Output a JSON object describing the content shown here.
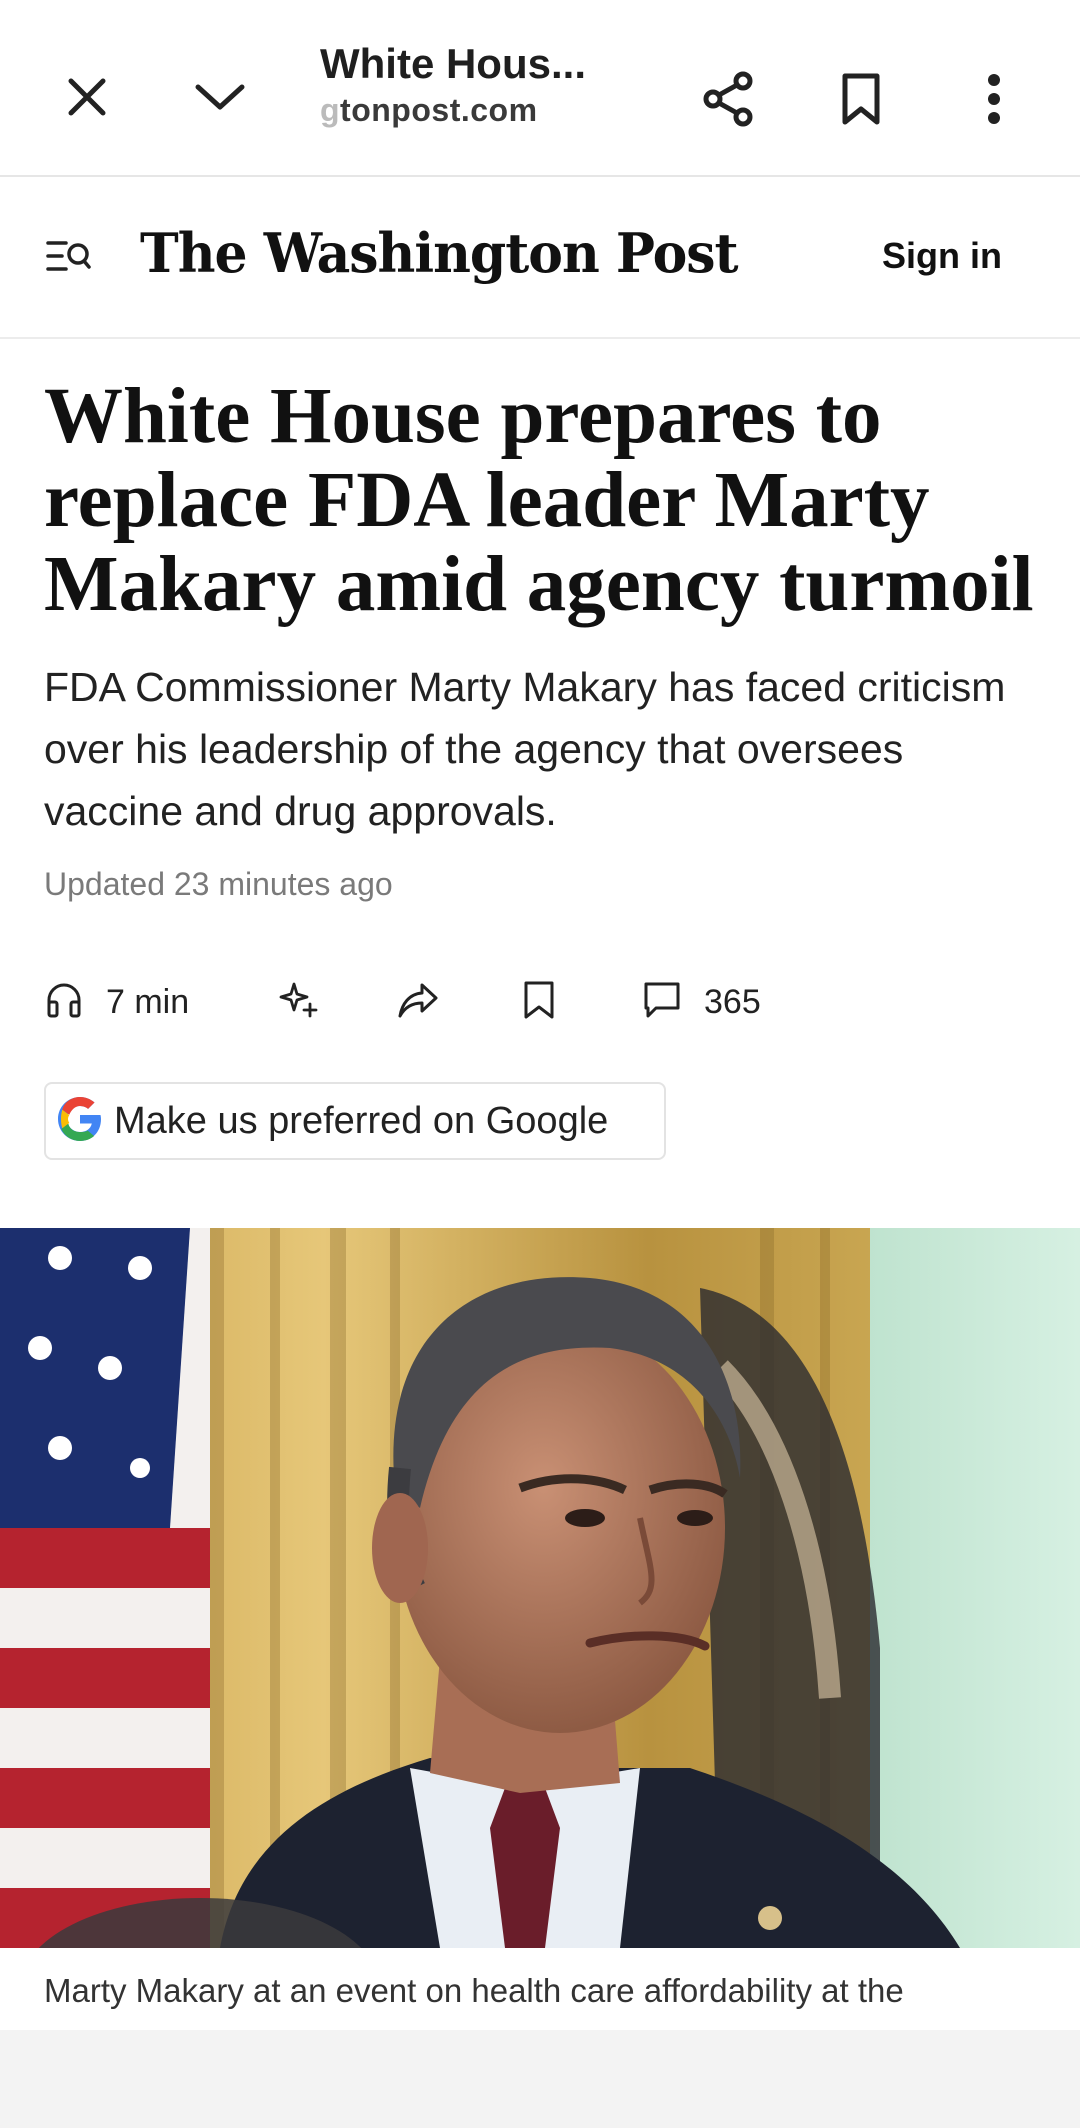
{
  "browser": {
    "title": "White Hous...",
    "domain_faded": "g",
    "domain": "tonpost.com"
  },
  "header": {
    "logo": "The Washington Post",
    "sign_in": "Sign in"
  },
  "article": {
    "headline": "White House prepares to replace FDA leader Marty Makary amid agency turmoil",
    "dek": "FDA Commissioner Marty Makary has faced criticism over his leadership of the agency that oversees vaccine and drug approvals.",
    "updated": "Updated 23 minutes ago",
    "listen_label": "7 min",
    "comments_count": "365",
    "google_button": "Make us preferred on Google",
    "caption": "Marty Makary at an event on health care affordability at the"
  },
  "icons": {
    "close": "close-icon",
    "collapse": "chevron-down-icon",
    "share": "share-icon",
    "bookmark": "bookmark-icon",
    "more": "more-vertical-icon",
    "menu_search": "menu-search-icon",
    "listen": "headphones-icon",
    "ai": "sparkle-icon",
    "article_share": "share-arrow-icon",
    "save": "bookmark-outline-icon",
    "comments": "comment-icon",
    "google": "google-g-icon"
  },
  "colors": {
    "text": "#111111",
    "google_blue": "#4285F4",
    "google_red": "#EA4335",
    "google_yellow": "#FBBC05",
    "google_green": "#34A853"
  }
}
